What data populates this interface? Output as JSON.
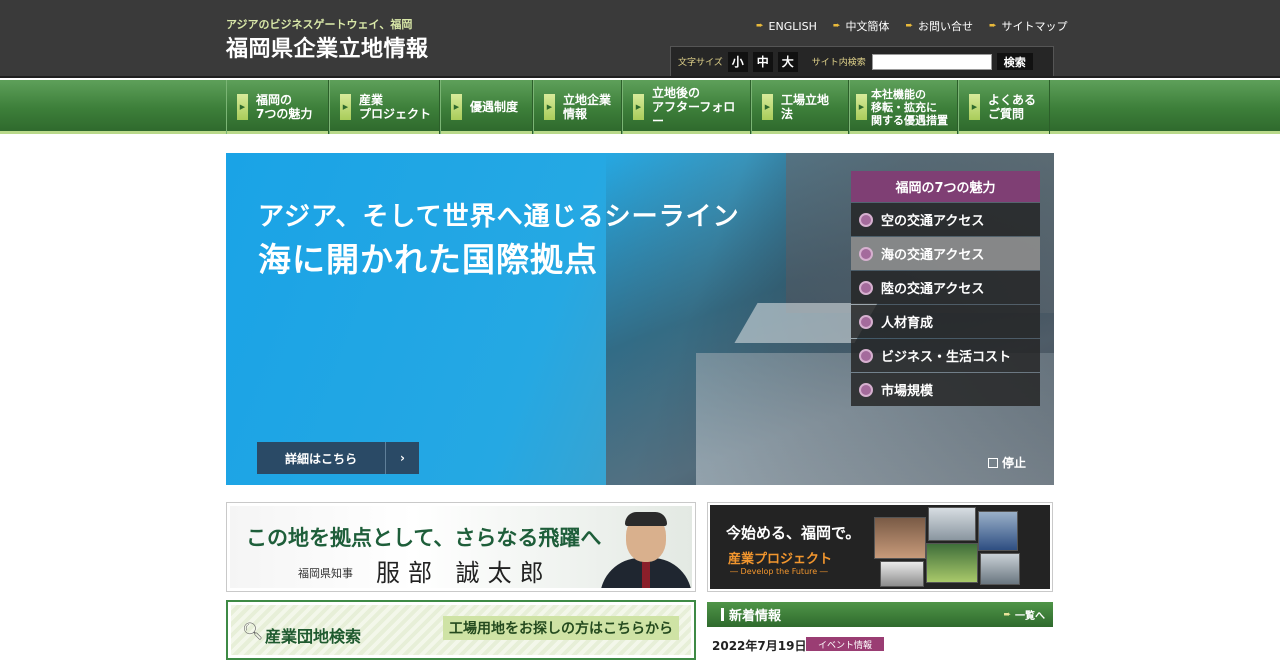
{
  "header": {
    "tagline": "アジアのビジネスゲートウェイ、福岡",
    "site_title": "福岡県企業立地情報",
    "links": [
      "ENGLISH",
      "中文簡体",
      "お問い合せ",
      "サイトマップ"
    ],
    "font_size_label": "文字サイズ",
    "font_sizes": [
      "小",
      "中",
      "大"
    ],
    "search_label": "サイト内検索",
    "search_value": "",
    "search_button": "検索"
  },
  "nav": {
    "items": [
      "福岡の\n7つの魅力",
      "産業\nプロジェクト",
      "優遇制度",
      "立地企業\n情報",
      "立地後の\nアフターフォロー",
      "工場立地法",
      "本社機能の\n移転・拡充に\n関する優遇措置",
      "よくある\nご質問"
    ]
  },
  "hero": {
    "subtitle": "アジア、そして世界へ通じるシーライン",
    "title": "海に開かれた国際拠点",
    "detail_button": "詳細はこちら",
    "detail_chevron": "›",
    "stop_label": "停止",
    "charm_title": "福岡の7つの魅力",
    "charm_items": [
      {
        "label": "空の交通アクセス",
        "active": false
      },
      {
        "label": "海の交通アクセス",
        "active": true
      },
      {
        "label": "陸の交通アクセス",
        "active": false
      },
      {
        "label": "人材育成",
        "active": false
      },
      {
        "label": "ビジネス・生活コスト",
        "active": false
      },
      {
        "label": "市場規模",
        "active": false
      }
    ]
  },
  "banner_governor": {
    "headline": "この地を拠点として、さらなる飛躍へ",
    "role": "福岡県知事",
    "name": "服部 誠太郎"
  },
  "banner_project": {
    "headline": "今始める、福岡で。",
    "title": "産業プロジェクト",
    "subtitle": "― Develop the Future ―"
  },
  "estate_search": {
    "title": "産業団地検索",
    "link": "工場用地をお探しの方はこちらから"
  },
  "news": {
    "title": "新着情報",
    "more": "一覧へ",
    "items": [
      {
        "date": "2022年7月19日",
        "tag": "イベント情報"
      }
    ]
  },
  "colors": {
    "header_bg": "#3a3a3a",
    "nav_green": "#3d7f3a",
    "charm_purple": "#7f3f74",
    "project_orange": "#f2962e",
    "news_tag": "#9a3d73"
  }
}
